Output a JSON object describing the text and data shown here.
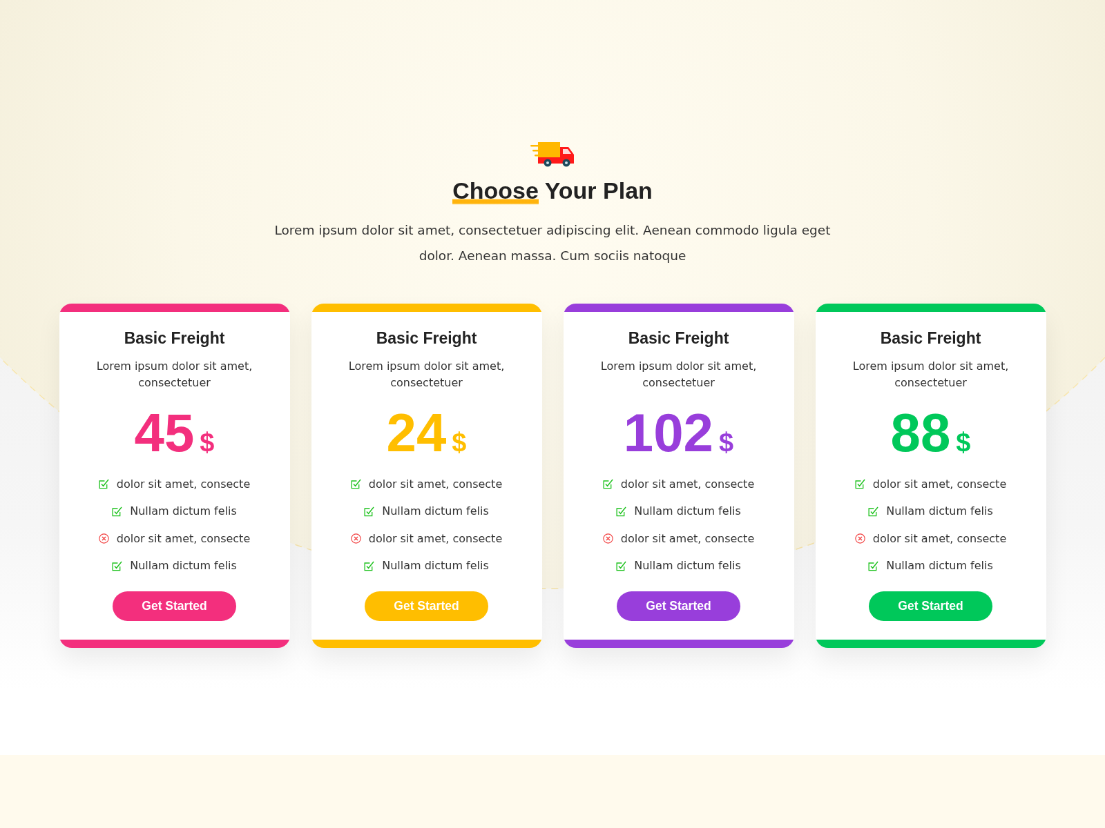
{
  "header": {
    "title": {
      "highlighted": "Choose",
      "rest": "Your Plan"
    },
    "subtitle": "Lorem ipsum dolor sit amet, consectetuer adipiscing elit. Aenean commodo ligula eget dolor. Aenean massa. Cum sociis natoque"
  },
  "plans": [
    {
      "name": "Basic Freight",
      "description": "Lorem ipsum dolor sit amet, consectetuer",
      "price": "45",
      "currency": "$",
      "color": "#f32f7d",
      "features": [
        {
          "text": "dolor sit amet, consecte",
          "included": true
        },
        {
          "text": "Nullam dictum felis",
          "included": true
        },
        {
          "text": "dolor sit amet, consecte",
          "included": false
        },
        {
          "text": "Nullam dictum felis",
          "included": true
        }
      ],
      "button": "Get Started"
    },
    {
      "name": "Basic Freight",
      "description": "Lorem ipsum dolor sit amet, consectetuer",
      "price": "24",
      "currency": "$",
      "color": "#ffbe00",
      "features": [
        {
          "text": "dolor sit amet, consecte",
          "included": true
        },
        {
          "text": "Nullam dictum felis",
          "included": true
        },
        {
          "text": "dolor sit amet, consecte",
          "included": false
        },
        {
          "text": "Nullam dictum felis",
          "included": true
        }
      ],
      "button": "Get Started"
    },
    {
      "name": "Basic Freight",
      "description": "Lorem ipsum dolor sit amet, consectetuer",
      "price": "102",
      "currency": "$",
      "color": "#983edb",
      "features": [
        {
          "text": "dolor sit amet, consecte",
          "included": true
        },
        {
          "text": "Nullam dictum felis",
          "included": true
        },
        {
          "text": "dolor sit amet, consecte",
          "included": false
        },
        {
          "text": "Nullam dictum felis",
          "included": true
        }
      ],
      "button": "Get Started"
    },
    {
      "name": "Basic Freight",
      "description": "Lorem ipsum dolor sit amet, consectetuer",
      "price": "88",
      "currency": "$",
      "color": "#00c85a",
      "features": [
        {
          "text": "dolor sit amet, consecte",
          "included": true
        },
        {
          "text": "Nullam dictum felis",
          "included": true
        },
        {
          "text": "dolor sit amet, consecte",
          "included": false
        },
        {
          "text": "Nullam dictum felis",
          "included": true
        }
      ],
      "button": "Get Started"
    }
  ]
}
